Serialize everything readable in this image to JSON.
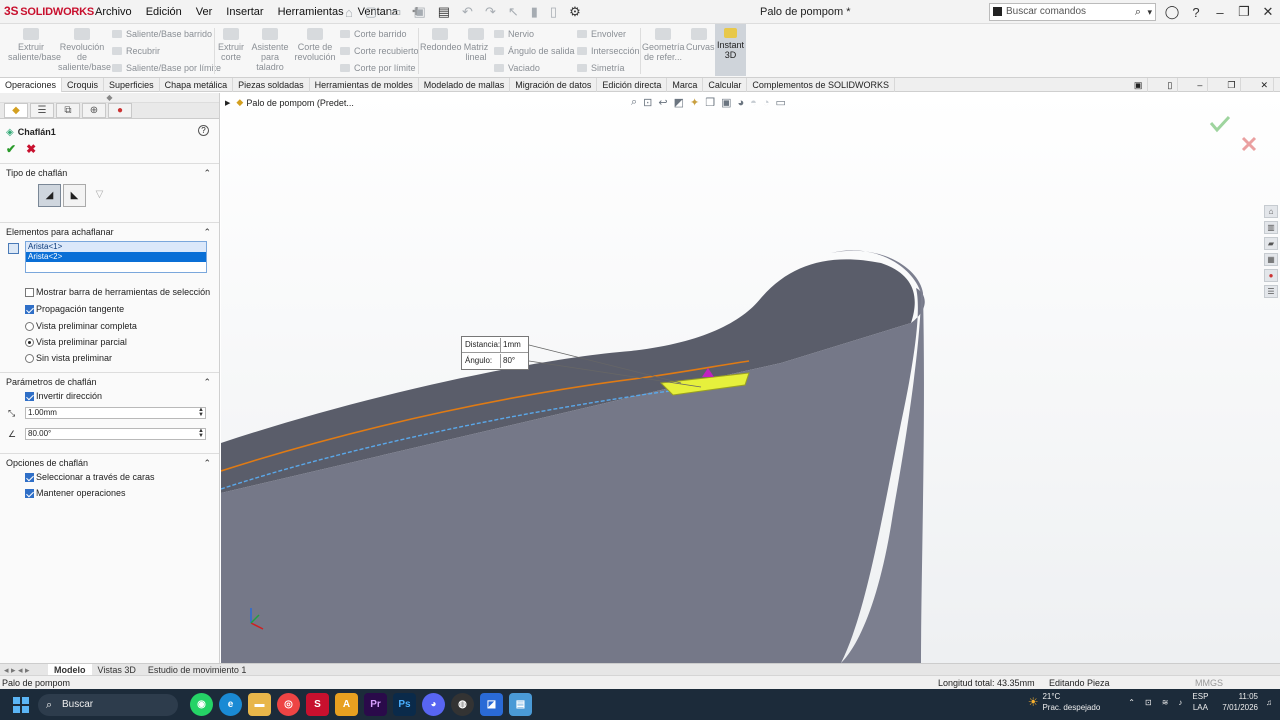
{
  "app": {
    "brand": "SOLIDWORKS",
    "brand_prefix": "3S",
    "doc_title": "Palo de pompom *"
  },
  "menus": [
    "Archivo",
    "Edición",
    "Ver",
    "Insertar",
    "Herramientas",
    "Ventana"
  ],
  "search": {
    "placeholder": "Buscar comandos"
  },
  "ribbon": {
    "extruir": "Extruir saliente/base",
    "revolucion": "Revolución de saliente/base",
    "barrido": "Saliente/Base barrido",
    "recubrir": "Recubrir",
    "limite": "Saliente/Base por límite",
    "extruir_corte": "Extruir corte",
    "asistente": "Asistente para taladro",
    "corte_rev": "Corte de revolución",
    "corte_barrido": "Corte barrido",
    "corte_recub": "Corte recubierto",
    "corte_limite": "Corte por límite",
    "redondeo": "Redondeo",
    "matriz": "Matriz lineal",
    "nervio": "Nervio",
    "angulo": "Ángulo de salida",
    "vaciado": "Vaciado",
    "envolver": "Envolver",
    "interseccion": "Intersección",
    "simetria": "Simetría",
    "geometria": "Geometría de refer...",
    "curvas": "Curvas",
    "instant3d": "Instant 3D"
  },
  "tabs": [
    "Operaciones",
    "Croquis",
    "Superficies",
    "Chapa metálica",
    "Piezas soldadas",
    "Herramientas de moldes",
    "Modelado de mallas",
    "Migración de datos",
    "Edición directa",
    "Marca",
    "Calcular",
    "Complementos de SOLIDWORKS"
  ],
  "panel": {
    "feature_name": "Chaflán1",
    "help": "?",
    "sec_tipo": "Tipo de chaflán",
    "sec_elementos": "Elementos para achaflanar",
    "items": [
      "Arista<1>",
      "Arista<2>"
    ],
    "opt_mostrar": "Mostrar barra de herramientas de selección",
    "opt_propagacion": "Propagación tangente",
    "opt_vista_completa": "Vista preliminar completa",
    "opt_vista_parcial": "Vista preliminar parcial",
    "opt_sin_vista": "Sin vista preliminar",
    "sec_parametros": "Parámetros de chaflán",
    "opt_invertir": "Invertir dirección",
    "distance_value": "1.00mm",
    "angle_value": "80.00°",
    "sec_opciones": "Opciones de chaflán",
    "opt_seleccionar": "Seleccionar a través de caras",
    "opt_mantener": "Mantener operaciones"
  },
  "viewport": {
    "breadcrumb": "Palo de pompom (Predet...",
    "callout_dist_label": "Distancia:",
    "callout_dist_value": "1mm",
    "callout_angle_label": "Ángulo:",
    "callout_angle_value": "80°"
  },
  "bottom_tabs": [
    "Modelo",
    "Vistas 3D",
    "Estudio de movimiento 1"
  ],
  "status": {
    "left": "Palo de pompom",
    "length": "Longitud total: 43.35mm",
    "mode": "Editando Pieza",
    "units": "MMGS"
  },
  "taskbar": {
    "search": "Buscar",
    "temp": "21°C",
    "weather": "Prac. despejado",
    "lang1": "ESP",
    "lang2": "LAA",
    "time": "11:05",
    "date": "7/01/2026"
  },
  "colors": {
    "accent": "#c8102e",
    "selection": "#0a6fd6",
    "edge_orange": "#e07b14",
    "chamfer_yellow": "#e6f03c",
    "model": "#727686"
  }
}
